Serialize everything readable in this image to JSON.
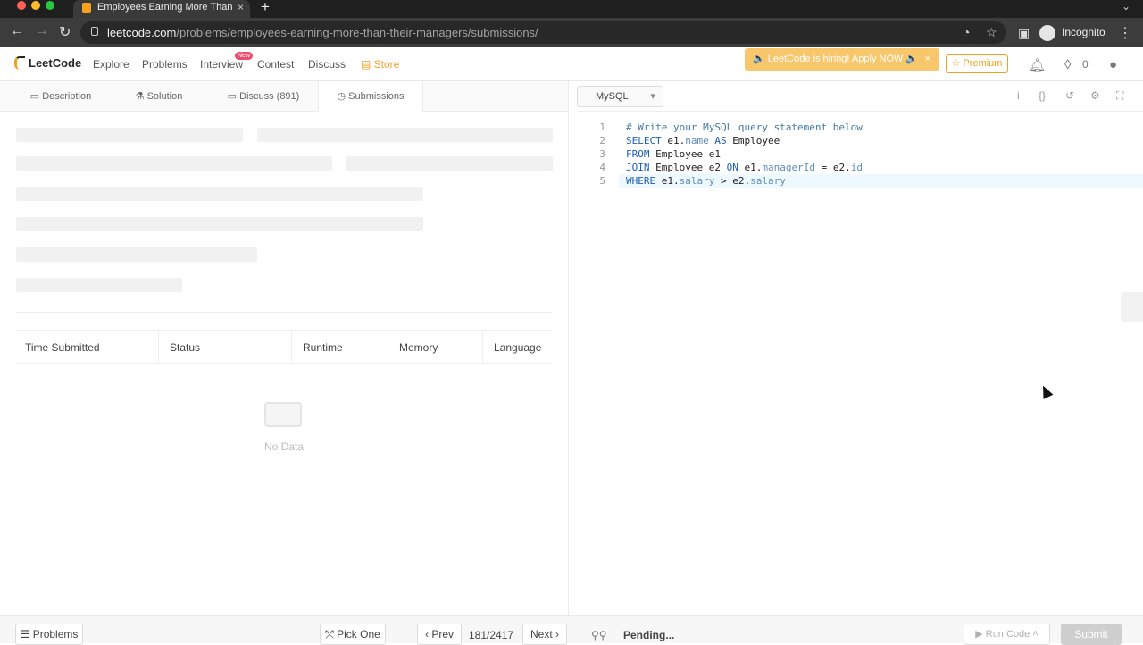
{
  "browser": {
    "tab_title": "Employees Earning More Than",
    "url_domain": "leetcode.com",
    "url_path": "/problems/employees-earning-more-than-their-managers/submissions/",
    "profile": "Incognito"
  },
  "nav": {
    "logo": "LeetCode",
    "links": [
      "Explore",
      "Problems",
      "Interview",
      "Contest",
      "Discuss",
      "Store"
    ],
    "new_badge": "New",
    "hiring_banner": "🔈 LeetCode is hiring! Apply NOW 🔈",
    "premium": "☆ Premium",
    "streak": "0"
  },
  "left_tabs": [
    "Description",
    "Solution",
    "Discuss (891)",
    "Submissions"
  ],
  "table_headers": [
    "Time Submitted",
    "Status",
    "Runtime",
    "Memory",
    "Language"
  ],
  "empty_state": "No Data",
  "editor": {
    "language": "MySQL",
    "line_numbers": [
      "1",
      "2",
      "3",
      "4",
      "5"
    ]
  },
  "footer": {
    "problems_button": "☰ Problems",
    "pick_one": "⤱ Pick One",
    "prev": "‹  Prev",
    "page": "181/2417",
    "next": "Next  ›",
    "pending": "Pending...",
    "run_code": "▶ Run Code ˄",
    "submit": "Submit"
  },
  "colors": {
    "accent": "#f89f1b",
    "premium": "#f0a020",
    "keyword": "#1d5fb3"
  }
}
